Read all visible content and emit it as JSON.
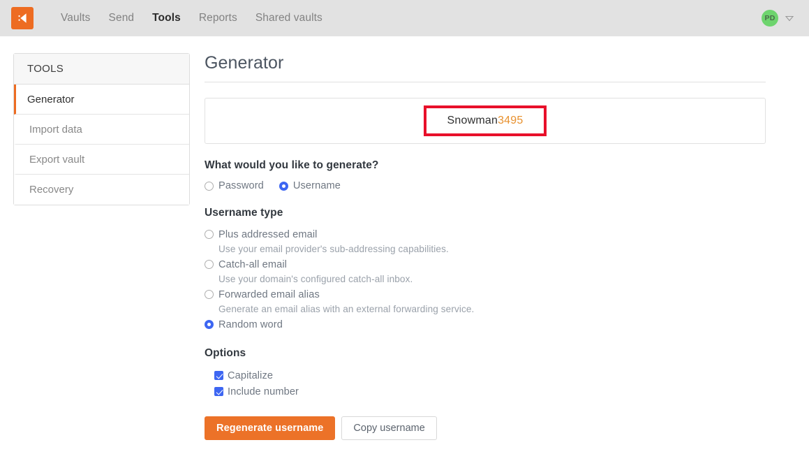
{
  "navbar": {
    "logo_icon": "bitwarden-shield-logo",
    "links": [
      {
        "label": "Vaults",
        "active": false
      },
      {
        "label": "Send",
        "active": false
      },
      {
        "label": "Tools",
        "active": true
      },
      {
        "label": "Reports",
        "active": false
      },
      {
        "label": "Shared vaults",
        "active": false
      }
    ],
    "avatar_initials": "PD",
    "avatar_color": "#6ed46e",
    "caret_icon": "chevron-down-icon"
  },
  "sidebar": {
    "header": "TOOLS",
    "items": [
      {
        "label": "Generator",
        "active": true
      },
      {
        "label": "Import data",
        "active": false
      },
      {
        "label": "Export vault",
        "active": false
      },
      {
        "label": "Recovery",
        "active": false
      }
    ],
    "active_accent": "#ed6c22"
  },
  "main": {
    "title": "Generator",
    "generated": {
      "word": "Snowman",
      "digits": "3495",
      "word_color": "#303030",
      "digits_color": "#e8912f",
      "highlight_color": "#e8102a"
    },
    "generate_question": {
      "title": "What would you like to generate?",
      "options": [
        {
          "label": "Password",
          "checked": false
        },
        {
          "label": "Username",
          "checked": true
        }
      ]
    },
    "username_type": {
      "title": "Username type",
      "options": [
        {
          "label": "Plus addressed email",
          "description": "Use your email provider's sub-addressing capabilities.",
          "checked": false
        },
        {
          "label": "Catch-all email",
          "description": "Use your domain's configured catch-all inbox.",
          "checked": false
        },
        {
          "label": "Forwarded email alias",
          "description": "Generate an email alias with an external forwarding service.",
          "checked": false
        },
        {
          "label": "Random word",
          "description": "",
          "checked": true
        }
      ]
    },
    "options": {
      "title": "Options",
      "checkboxes": [
        {
          "label": "Capitalize",
          "checked": true
        },
        {
          "label": "Include number",
          "checked": true
        }
      ]
    },
    "buttons": {
      "primary": "Regenerate username",
      "secondary": "Copy username",
      "primary_color": "#ec7228"
    }
  }
}
